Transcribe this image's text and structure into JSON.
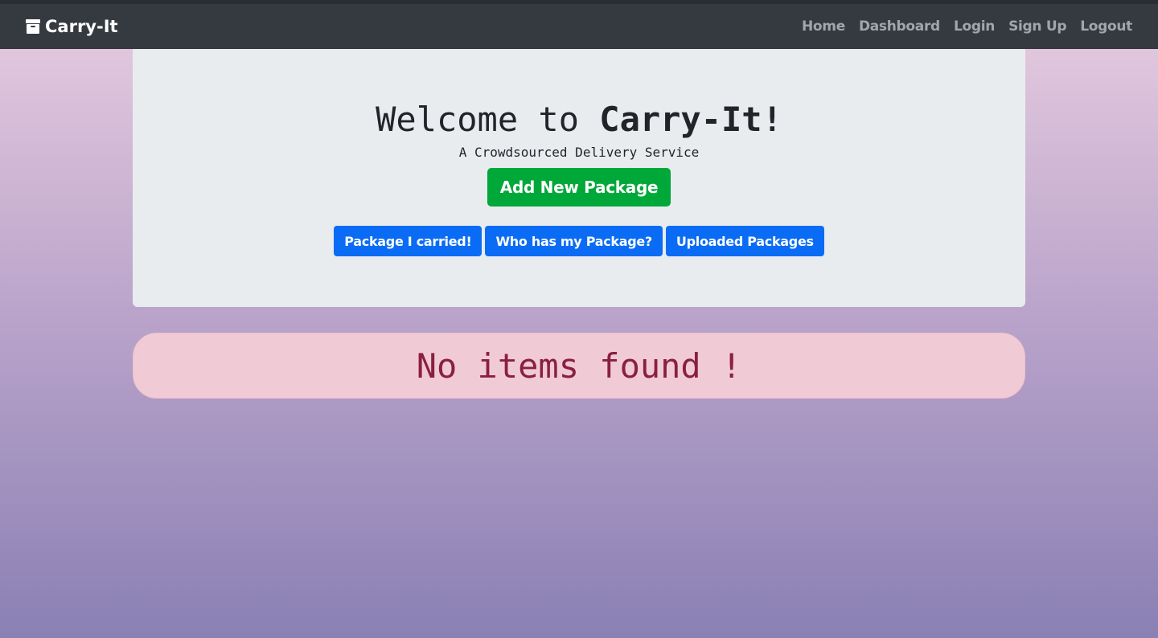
{
  "navbar": {
    "brand": "Carry-It",
    "brand_icon": "archive-box-icon",
    "links": [
      "Home",
      "Dashboard",
      "Login",
      "Sign Up",
      "Logout"
    ]
  },
  "hero": {
    "welcome_prefix": "Welcome to ",
    "welcome_brand": "Carry-It!",
    "tagline": "A Crowdsourced Delivery Service",
    "add_button": "Add New Package",
    "buttons": [
      "Package I carried!",
      "Who has my Package?",
      "Uploaded Packages"
    ]
  },
  "alert": {
    "message": "No items found !"
  },
  "colors": {
    "navbar": "#343a40",
    "success": "#00a83a",
    "primary": "#0a6cf5",
    "alert_bg": "#f0cbd5",
    "alert_text": "#8a1f43"
  }
}
